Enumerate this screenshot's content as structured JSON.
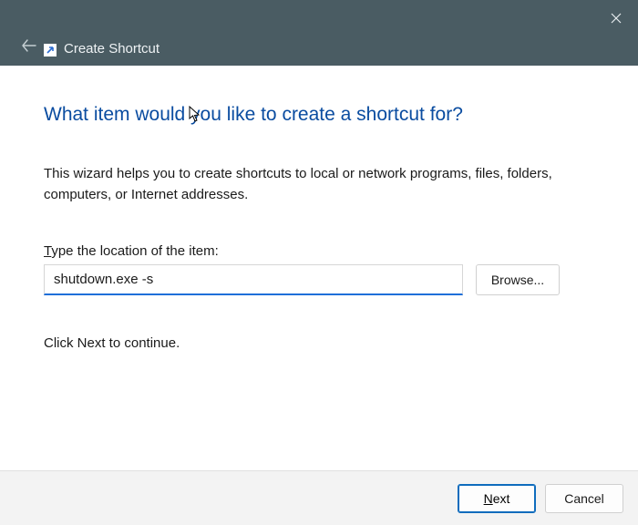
{
  "titlebar": {
    "title": "Create Shortcut"
  },
  "main": {
    "heading": "What item would you like to create a shortcut for?",
    "description": "This wizard helps you to create shortcuts to local or network programs, files, folders, computers, or Internet addresses.",
    "field_label_prefix": "T",
    "field_label_rest": "ype the location of the item:",
    "input_value": "shutdown.exe -s",
    "browse_label": "Browse...",
    "hint": "Click Next to continue."
  },
  "footer": {
    "next_underline": "N",
    "next_rest": "ext",
    "cancel_label": "Cancel"
  }
}
